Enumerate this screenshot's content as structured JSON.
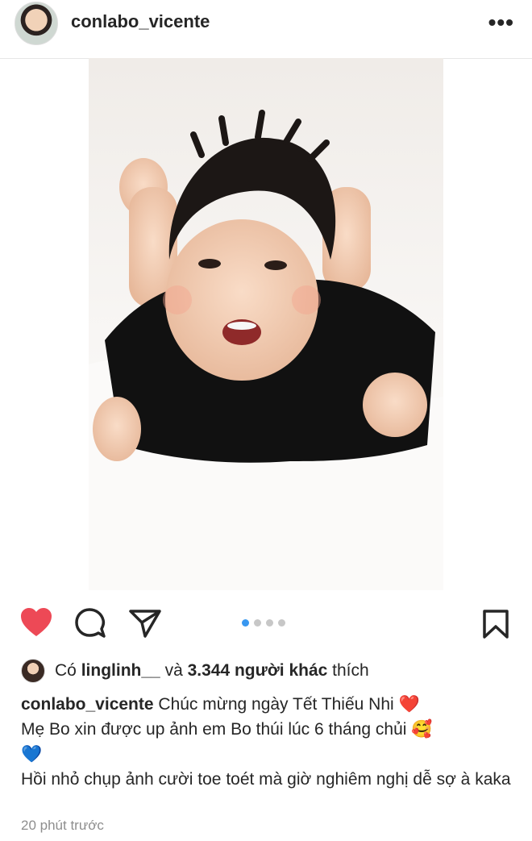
{
  "header": {
    "username": "conlabo_vicente",
    "more": "•••"
  },
  "post": {
    "photo": "baby-lying-on-white-bed-photo"
  },
  "carousel": {
    "count": 4,
    "active": 1
  },
  "likes": {
    "prefix": "Có",
    "user": "linglinh__",
    "middle": "và",
    "count": "3.344 người khác",
    "suffix": "thích"
  },
  "caption": {
    "username": "conlabo_vicente",
    "line1": "Chúc mừng ngày Tết Thiếu Nhi ❤️",
    "line2": "Mẹ Bo xin được up ảnh em Bo thúi lúc 6 tháng chủi 🥰",
    "line3": "💙",
    "line4": "Hồi nhỏ chụp ảnh cười toe toét mà giờ nghiêm nghị dễ sợ à kaka"
  },
  "timestamp": "20 phút trước",
  "colors": {
    "heart": "#ed4956",
    "dot_active": "#3897f0",
    "dot": "#c7c7c7"
  }
}
